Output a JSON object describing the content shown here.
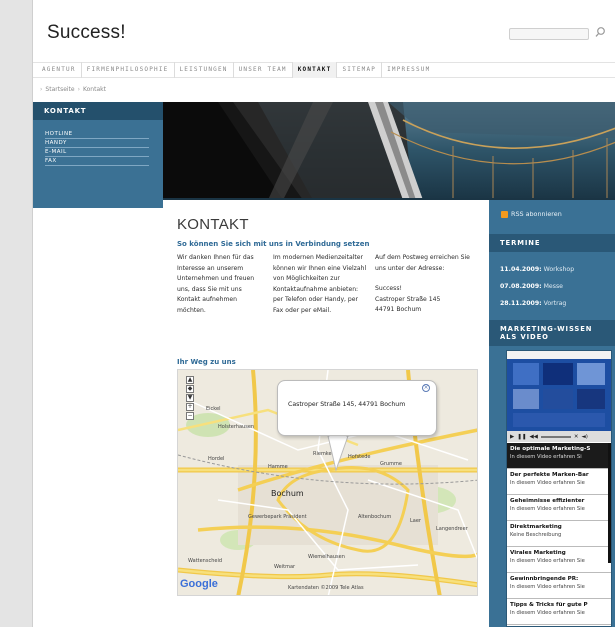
{
  "header": {
    "site_title": "Success!",
    "search": {
      "placeholder": ""
    }
  },
  "nav": {
    "items": [
      {
        "label": "AGENTUR",
        "active": false
      },
      {
        "label": "FIRMENPHILOSOPHIE",
        "active": false
      },
      {
        "label": "LEISTUNGEN",
        "active": false
      },
      {
        "label": "UNSER TEAM",
        "active": false
      },
      {
        "label": "KONTAKT",
        "active": true
      },
      {
        "label": "SITEMAP",
        "active": false
      },
      {
        "label": "IMPRESSUM",
        "active": false
      }
    ]
  },
  "breadcrumb": {
    "home": "Startseite",
    "current": "Kontakt"
  },
  "left_nav": {
    "heading": "KONTAKT",
    "items": [
      "HOTLINE",
      "HANDY",
      "E-MAIL",
      "FAX"
    ]
  },
  "main": {
    "heading": "KONTAKT",
    "subheading": "So können Sie sich mit uns in Verbindung setzen",
    "col1": "Wir danken Ihnen für das Interesse an unserem Unternehmen und freuen uns, dass Sie mit uns Kontakt aufnehmen möchten.",
    "col2": "Im modernen Medienzeitalter können wir Ihnen eine Vielzahl von Möglichkeiten zur Kontaktaufnahme anbieten: per Telefon oder Handy, per Fax oder per eMail.",
    "col3_intro": "Auf dem Postweg erreichen Sie uns unter der Adresse:",
    "address": {
      "name": "Success!",
      "street": "Castroper Straße 145",
      "city": "44791 Bochum"
    },
    "map_heading": "Ihr Weg zu uns"
  },
  "map": {
    "bubble_text": "Castroper Straße 145, 44791 Bochum",
    "city_label": "Bochum",
    "places": [
      "Eickel",
      "Holsterhausen",
      "Hordel",
      "Hamme",
      "Riemke",
      "Hofstede",
      "Grumme",
      "Altenbochum",
      "Laer",
      "Langendreer",
      "Wiemelhausen",
      "Weitmar",
      "Gewerbepark Präsident",
      "Wattenscheid"
    ],
    "logo": "Google",
    "credit": "Kartendaten ©2009 Tele Atlas"
  },
  "right": {
    "rss_label": "RSS abonnieren",
    "termine_heading": "TERMINE",
    "termine": [
      {
        "date": "11.04.2009:",
        "title": "Workshop"
      },
      {
        "date": "07.08.2009:",
        "title": "Messe"
      },
      {
        "date": "28.11.2009:",
        "title": "Vortrag"
      }
    ],
    "mw_heading_1": "MARKETING-WISSEN",
    "mw_heading_2": "ALS VIDEO",
    "videos": [
      {
        "title": "Die optimale Marketing-S",
        "desc": "In diesem Video erfahren Si",
        "active": true
      },
      {
        "title": "Der perfekte Marken-Bar",
        "desc": "In diesem Video erfahren Sie",
        "active": false
      },
      {
        "title": "Geheimnisse effizienter",
        "desc": "In diesem Video erfahren Sie",
        "active": false
      },
      {
        "title": "Direktmarketing",
        "desc": "Keine Beschreibung",
        "active": false
      },
      {
        "title": "Virales Marketing",
        "desc": "In diesem Video erfahren Sie",
        "active": false
      },
      {
        "title": "Gewinnbringende PR:",
        "desc": "In diesem Video erfahren Sie",
        "active": false
      },
      {
        "title": "Tipps & Tricks für gute P",
        "desc": "In diesem Video erfahren Sie",
        "active": false
      }
    ]
  },
  "colors": {
    "accent_blue": "#3a7195",
    "dark_blue": "#2a5877",
    "link_blue": "#2f6a96",
    "rss_orange": "#f39a1e"
  }
}
